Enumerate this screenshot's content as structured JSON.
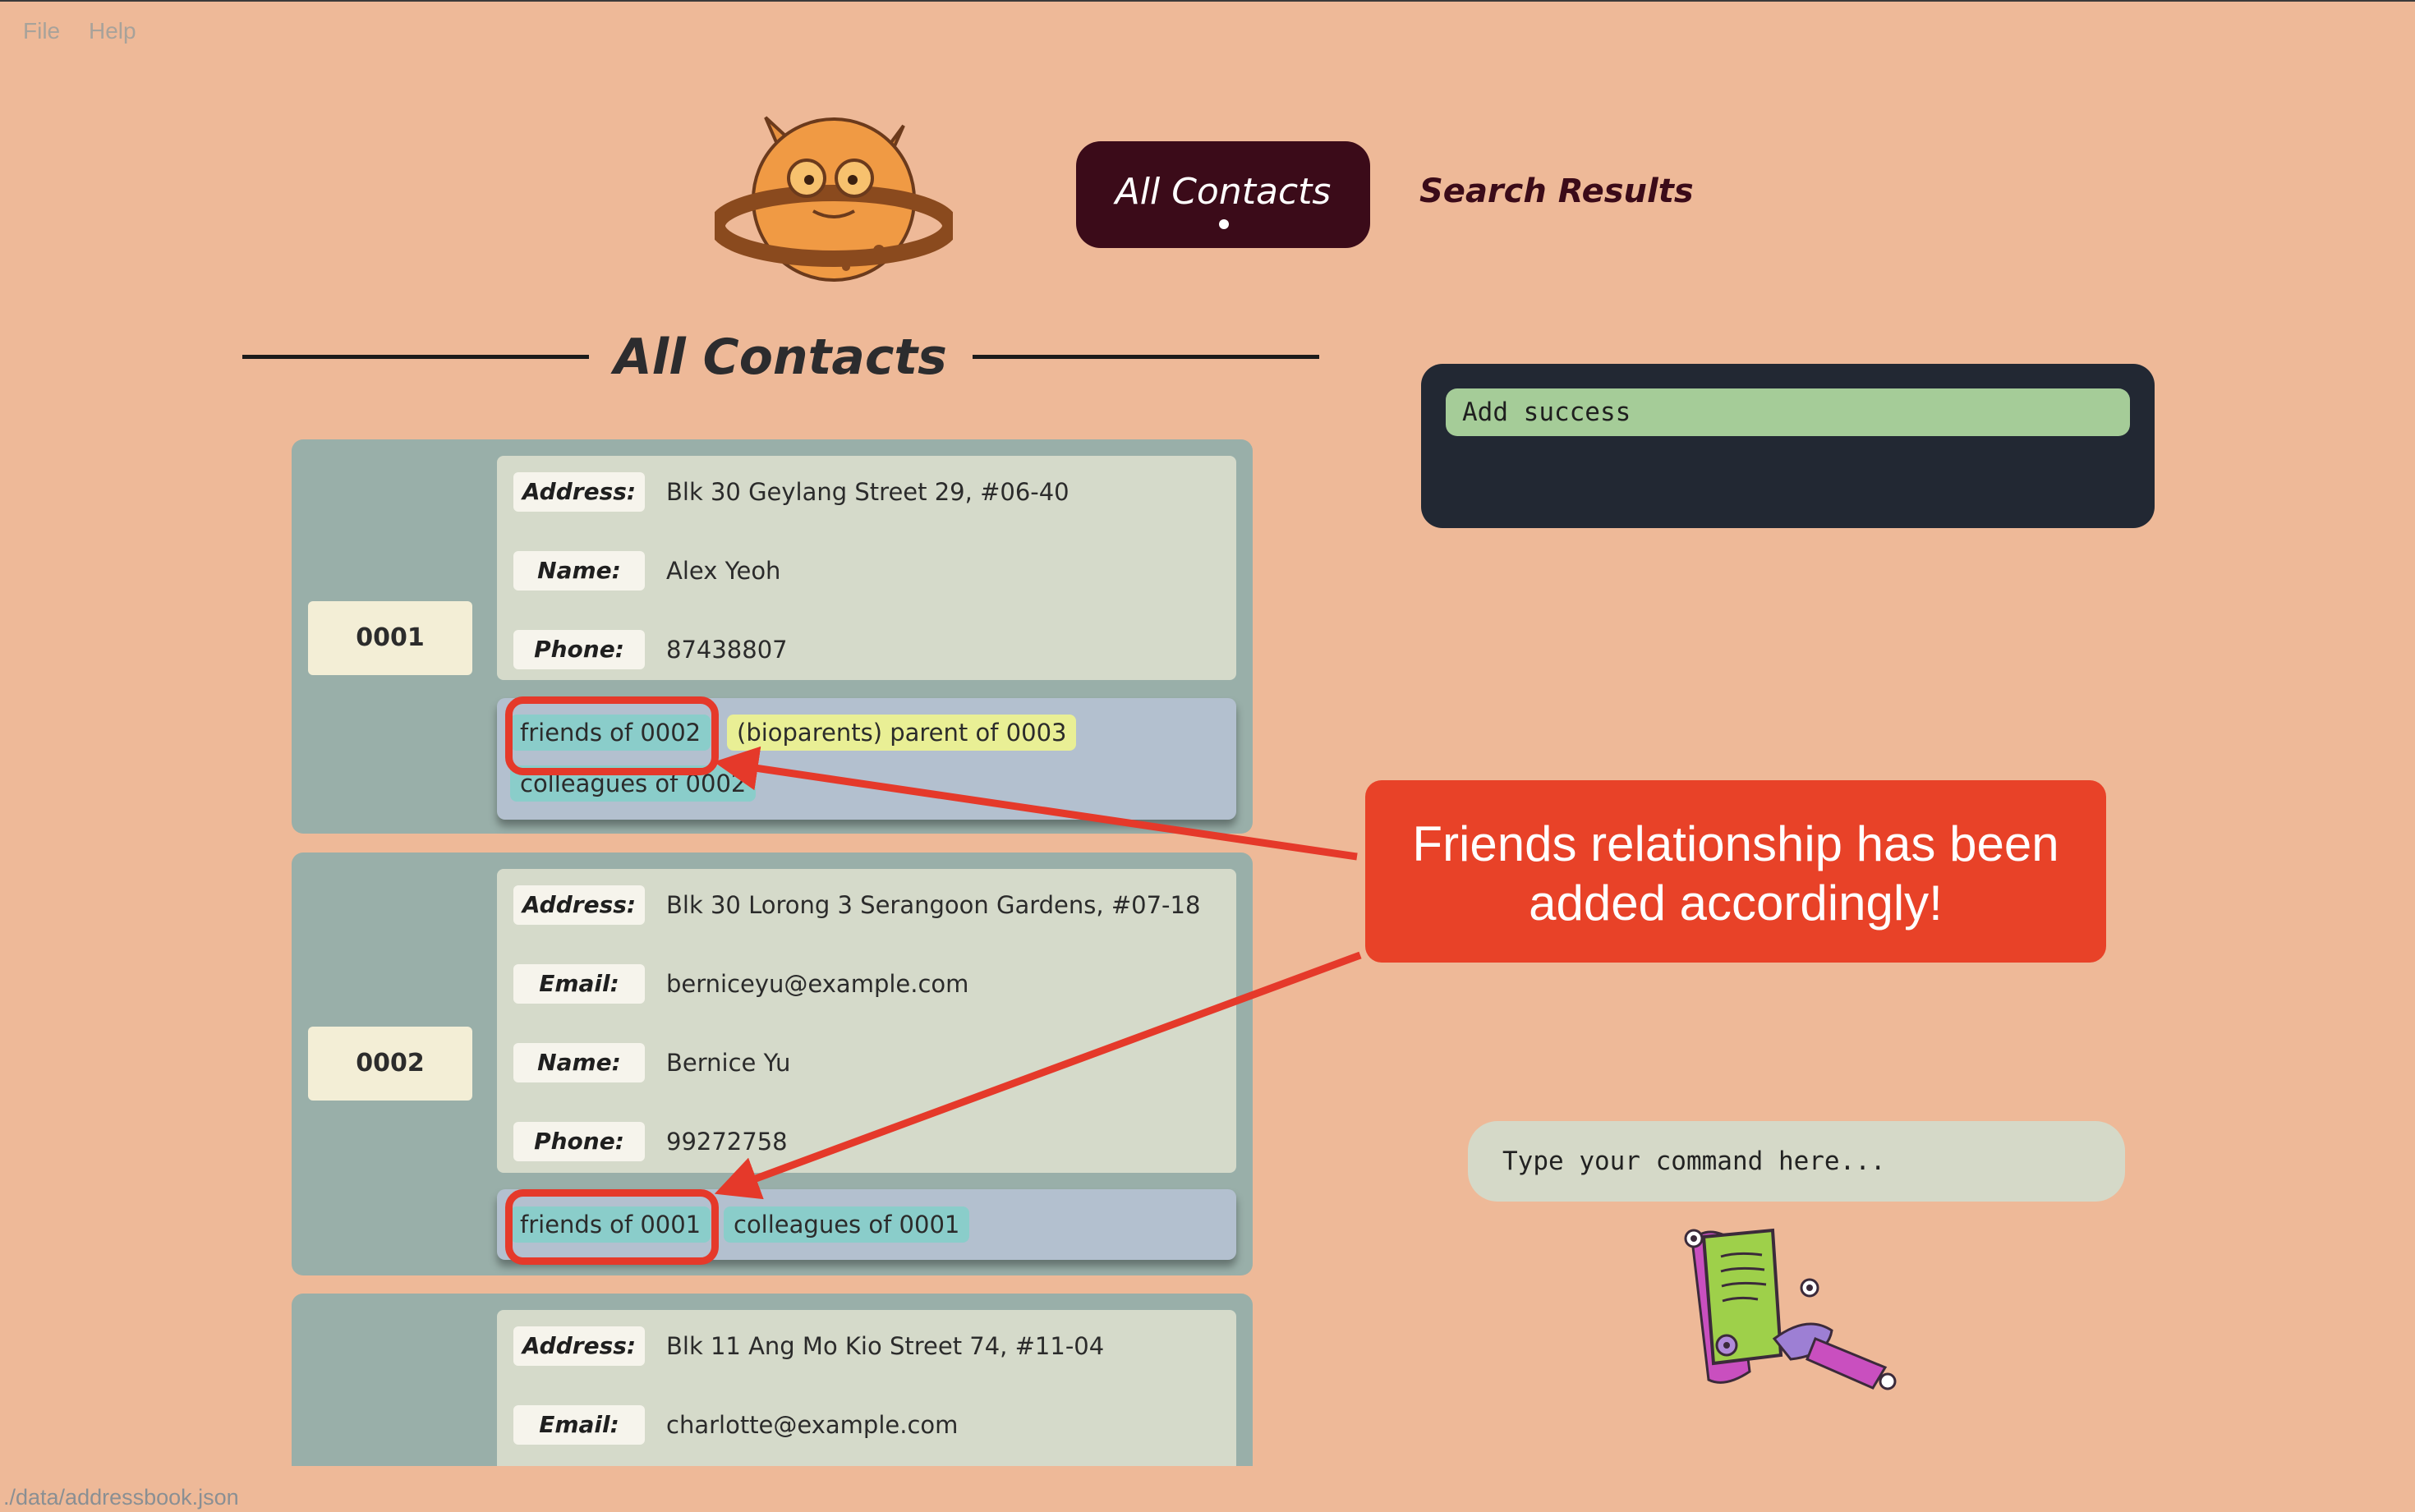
{
  "menu": {
    "file": "File",
    "help": "Help"
  },
  "nav": {
    "tab_all": "All Contacts",
    "tab_search": "Search Results",
    "active_tab": "All Contacts"
  },
  "heading": "All Contacts",
  "contacts": [
    {
      "id": "0001",
      "fields": [
        {
          "label": "Address:",
          "value": "Blk 30 Geylang Street 29, #06-40"
        },
        {
          "label": "Name:",
          "value": "Alex Yeoh"
        },
        {
          "label": "Phone:",
          "value": "87438807"
        }
      ],
      "tags": [
        "friends of 0002",
        "(bioparents) parent of 0003",
        "colleagues of 0002"
      ]
    },
    {
      "id": "0002",
      "fields": [
        {
          "label": "Address:",
          "value": "Blk 30 Lorong 3 Serangoon Gardens, #07-18"
        },
        {
          "label": "Email:",
          "value": "berniceyu@example.com"
        },
        {
          "label": "Name:",
          "value": "Bernice Yu"
        },
        {
          "label": "Phone:",
          "value": "99272758"
        }
      ],
      "tags": [
        "friends of 0001",
        "colleagues of 0001"
      ]
    },
    {
      "id": "",
      "fields": [
        {
          "label": "Address:",
          "value": "Blk 11 Ang Mo Kio Street 74, #11-04"
        },
        {
          "label": "Email:",
          "value": "charlotte@example.com"
        }
      ],
      "tags": []
    }
  ],
  "result": {
    "message": "Add success"
  },
  "callout": {
    "text": "Friends relationship has been added accordingly!"
  },
  "command": {
    "placeholder": "Type your command here..."
  },
  "status": {
    "path": "./data/addressbook.json"
  },
  "colors": {
    "background": "#EEB998",
    "accent_dark": "#3B0B19",
    "card": "#99AFA9",
    "tag_teal": "#8ACDCA",
    "tag_yellow": "#E9EF95",
    "success": "#A5CC98",
    "callout": "#E84228"
  },
  "icons": {
    "logo": "cookie-planet-monster-logo",
    "mascot": "monster-writing-note-icon"
  }
}
